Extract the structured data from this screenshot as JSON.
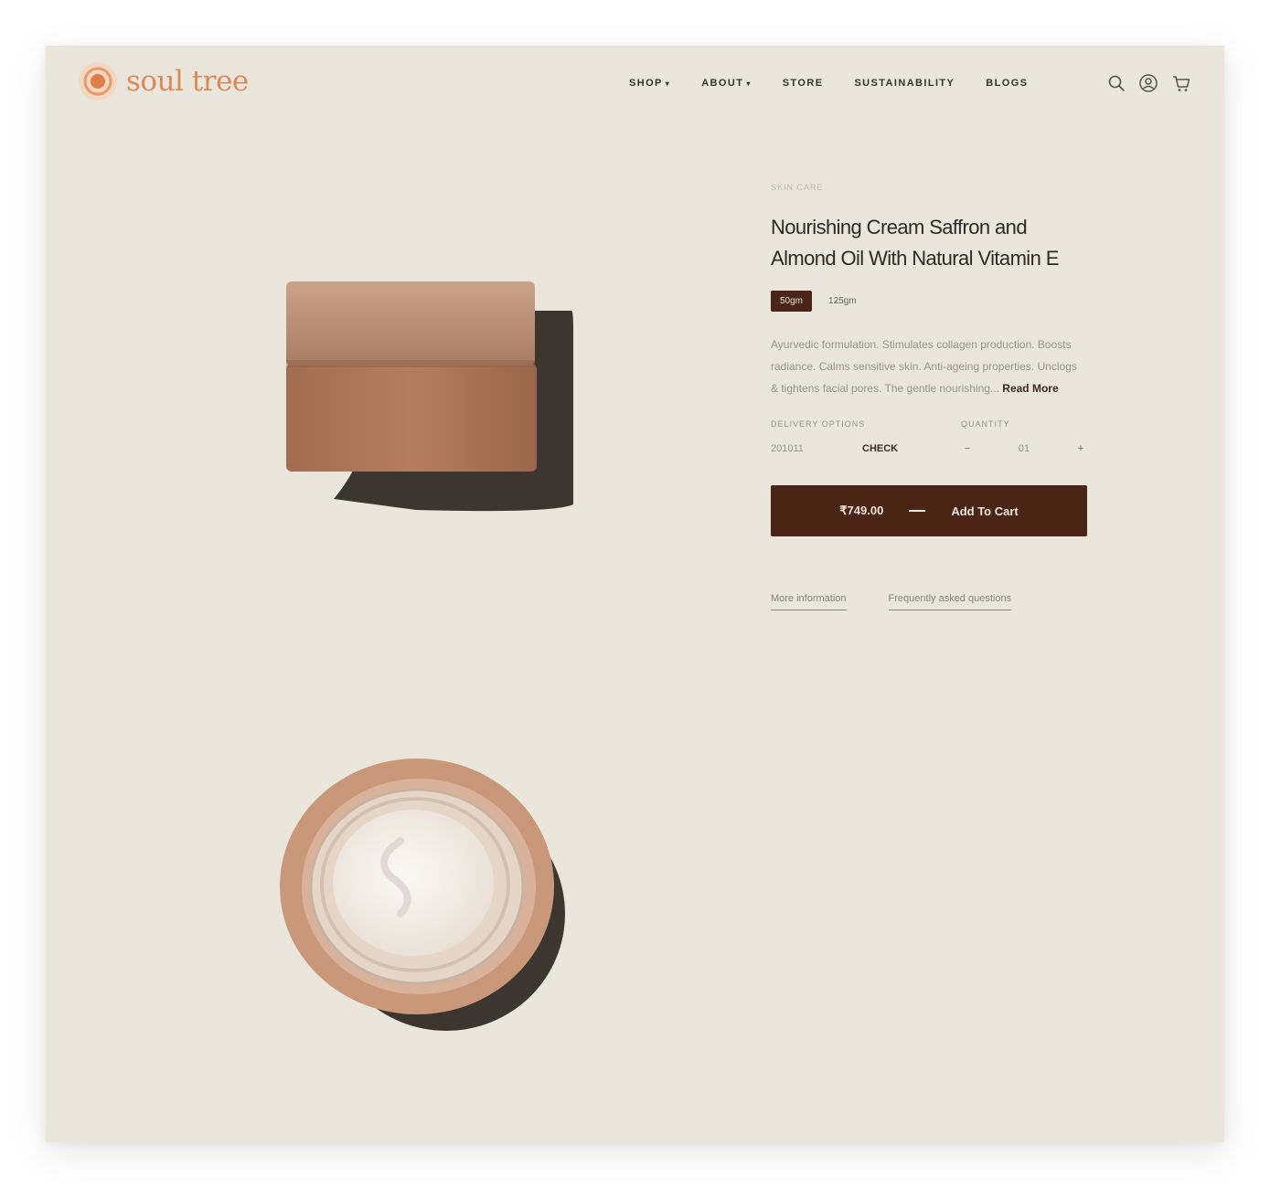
{
  "brand": {
    "name": "soul tree",
    "color": "#d98a5c"
  },
  "nav": {
    "items": [
      {
        "label": "SHOP",
        "has_caret": true
      },
      {
        "label": "ABOUT",
        "has_caret": true
      },
      {
        "label": "STORE",
        "has_caret": false
      },
      {
        "label": "SUSTAINABILITY",
        "has_caret": false
      },
      {
        "label": "BLOGS",
        "has_caret": false
      }
    ],
    "caret": "▾",
    "icons": [
      "search-icon",
      "account-icon",
      "cart-icon"
    ]
  },
  "product": {
    "breadcrumb": "SKIN CARE",
    "title_line1": "Nourishing Cream Saffron and",
    "title_line2": "Almond Oil With Natural Vitamin E",
    "sizes": [
      {
        "label": "50gm",
        "active": true
      },
      {
        "label": "125gm",
        "active": false
      }
    ],
    "description": "Ayurvedic formulation. Stimulates collagen production. Boosts radiance. Calms sensitive skin. Anti-ageing properties. Unclogs & tightens facial pores. The gentle nourishing...",
    "read_more": "Read More",
    "options": {
      "pincode_label": "DELIVERY OPTIONS",
      "quantity_label": "QUANTITY",
      "pincode_value": "201011",
      "check_label": "CHECK",
      "qty_minus": "−",
      "qty_value": "01",
      "qty_plus": "+"
    },
    "cart": {
      "price": "₹749.00",
      "label": "Add To Cart"
    },
    "links": {
      "more_info": "More information",
      "faq": "Frequently asked questions"
    }
  },
  "colors": {
    "background": "#ebe6dc",
    "accent_dark": "#4a2414",
    "jar": "#b98a6e"
  }
}
